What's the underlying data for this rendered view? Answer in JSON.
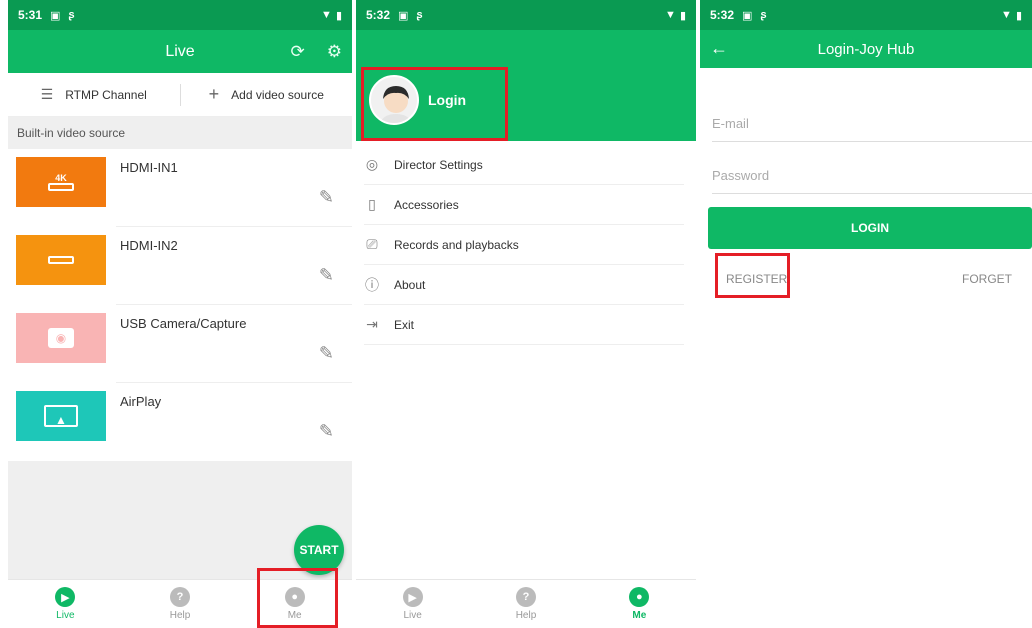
{
  "screen1": {
    "status": {
      "time": "5:31"
    },
    "title": "Live",
    "toolbar": {
      "rtmp": "RTMP Channel",
      "add": "Add video source"
    },
    "section_title": "Built-in video source",
    "sources": [
      {
        "name": "HDMI-IN1",
        "badge": "4K",
        "color": "#f27a0f"
      },
      {
        "name": "HDMI-IN2",
        "badge": "",
        "color": "#f5930f"
      },
      {
        "name": "USB Camera/Capture",
        "badge": "",
        "color": "#f9b4b4"
      },
      {
        "name": "AirPlay",
        "badge": "",
        "color": "#1ec7b8"
      }
    ],
    "start": "START",
    "nav": [
      {
        "label": "Live",
        "icon": "▶",
        "active": true
      },
      {
        "label": "Help",
        "icon": "?",
        "active": false
      },
      {
        "label": "Me",
        "icon": "●",
        "active": false
      }
    ]
  },
  "screen2": {
    "status": {
      "time": "5:32"
    },
    "login": "Login",
    "menu": [
      {
        "label": "Director Settings",
        "icon": "◎"
      },
      {
        "label": "Accessories",
        "icon": "▯"
      },
      {
        "label": "Records and playbacks",
        "icon": "⎚"
      },
      {
        "label": "About",
        "icon": "ⓘ"
      },
      {
        "label": "Exit",
        "icon": "⇥"
      }
    ],
    "nav": [
      {
        "label": "Live",
        "icon": "▶",
        "active": false
      },
      {
        "label": "Help",
        "icon": "?",
        "active": false
      },
      {
        "label": "Me",
        "icon": "●",
        "active": true
      }
    ]
  },
  "screen3": {
    "status": {
      "time": "5:32"
    },
    "title": "Login-Joy Hub",
    "email_placeholder": "E-mail",
    "password_placeholder": "Password",
    "login_button": "LOGIN",
    "register": "REGISTER",
    "forget": "FORGET"
  },
  "colors": {
    "primary": "#0fb865",
    "status_bar": "#0a9a52",
    "highlight": "#e41e26"
  }
}
